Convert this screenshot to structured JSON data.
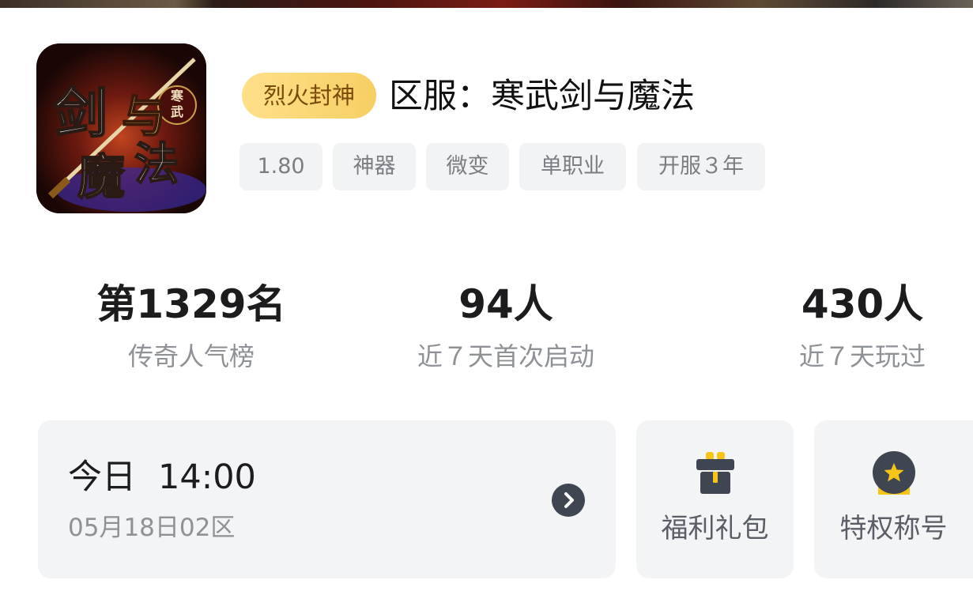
{
  "game": {
    "icon_name": "jianyumofa-app-icon",
    "icon_text": [
      "剑",
      "与",
      "魔",
      "法",
      "寒",
      "武"
    ],
    "server_badge": "烈火封神",
    "title": "区服：寒武剑与魔法",
    "tags": [
      "1.80",
      "神器",
      "微变",
      "单职业",
      "开服３年"
    ]
  },
  "stats": [
    {
      "value": "第1329名",
      "label": "传奇人气榜"
    },
    {
      "value": "94人",
      "label": "近７天首次启动"
    },
    {
      "value": "430人",
      "label": "近７天玩过"
    }
  ],
  "open_server": {
    "day": "今日",
    "time": "14:00",
    "server": "05月18日02区",
    "arrow_icon": "chevron-right-icon"
  },
  "actions": [
    {
      "label": "福利礼包",
      "icon": "gift-icon"
    },
    {
      "label": "特权称号",
      "icon": "badge-star-icon"
    }
  ],
  "colors": {
    "badge_gradient_start": "#ffe08a",
    "badge_gradient_end": "#f6cf63",
    "badge_text": "#7a4a07",
    "tag_bg": "#f2f3f5",
    "card_bg": "#f3f4f6",
    "icon_dark": "#3f4652",
    "icon_accent": "#f5c518"
  }
}
